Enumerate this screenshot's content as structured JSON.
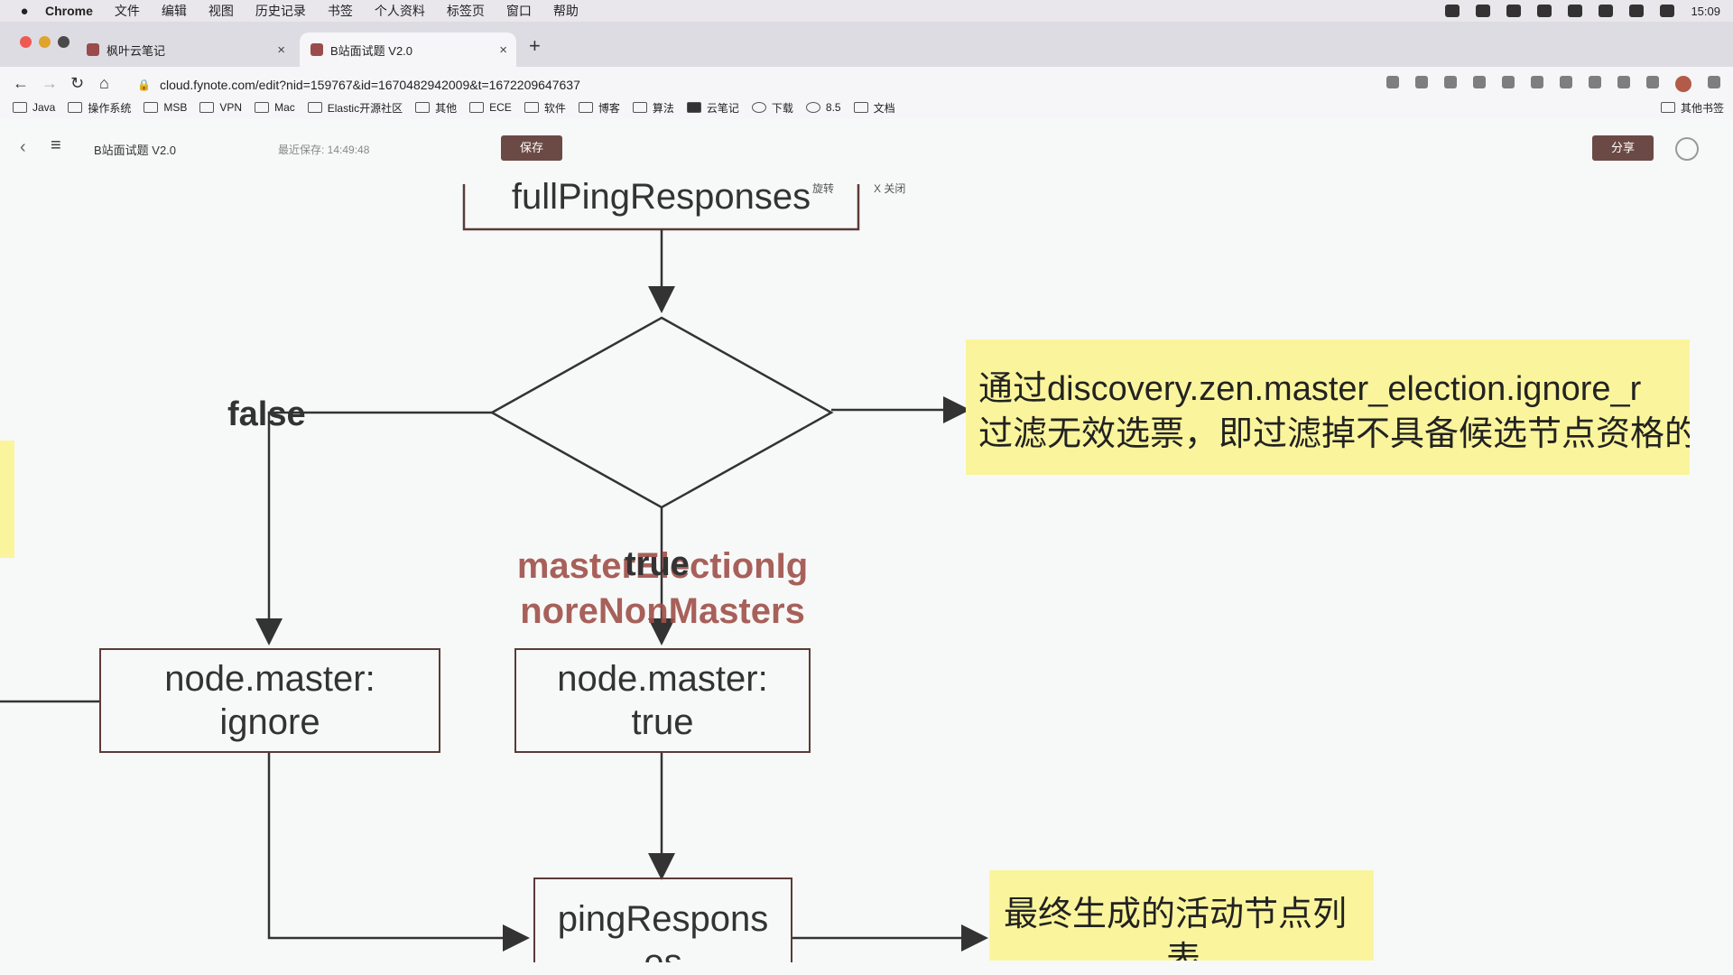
{
  "menubar": {
    "apple": "",
    "items": [
      "Chrome",
      "文件",
      "编辑",
      "视图",
      "历史记录",
      "书签",
      "个人资料",
      "标签页",
      "窗口",
      "帮助"
    ],
    "clock": "15:09"
  },
  "tabs": [
    {
      "title": "枫叶云笔记",
      "close": "×"
    },
    {
      "title": "B站面试题 V2.0",
      "close": "×"
    }
  ],
  "newtab": "+",
  "address": {
    "url": "cloud.fynote.com/edit?nid=159767&id=1670482942009&t=1672209647637"
  },
  "bookmarks": [
    "Java",
    "操作系统",
    "MSB",
    "VPN",
    "Mac",
    "Elastic开源社区",
    "其他",
    "ECE",
    "软件",
    "博客",
    "算法",
    "云笔记",
    "下载",
    "8.5",
    "文档"
  ],
  "bookmarks_other": "其他书签",
  "app": {
    "doc_title": "B站面试题 V2.0",
    "last_saved": "最近保存: 14:49:48",
    "save_label": "保存",
    "share_label": "分享"
  },
  "canvas_tools": {
    "rotate": "旋转",
    "close": "X 关闭"
  },
  "flow": {
    "top_node": "fullPingResponses",
    "decision": [
      "masterElectionIg",
      "noreNonMasters"
    ],
    "false_label": "false",
    "true_label": "true",
    "node_ignore": [
      "node.master:",
      "ignore"
    ],
    "node_true": [
      "node.master:",
      "true"
    ],
    "node_ping": [
      "pingRespons",
      "es"
    ],
    "note_top": [
      "通过discovery.zen.master_election.ignore_r",
      "过滤无效选票，即过滤掉不具备候选节点资格的"
    ],
    "note_bottom": [
      "最终生成的活动节点列",
      "表"
    ]
  }
}
